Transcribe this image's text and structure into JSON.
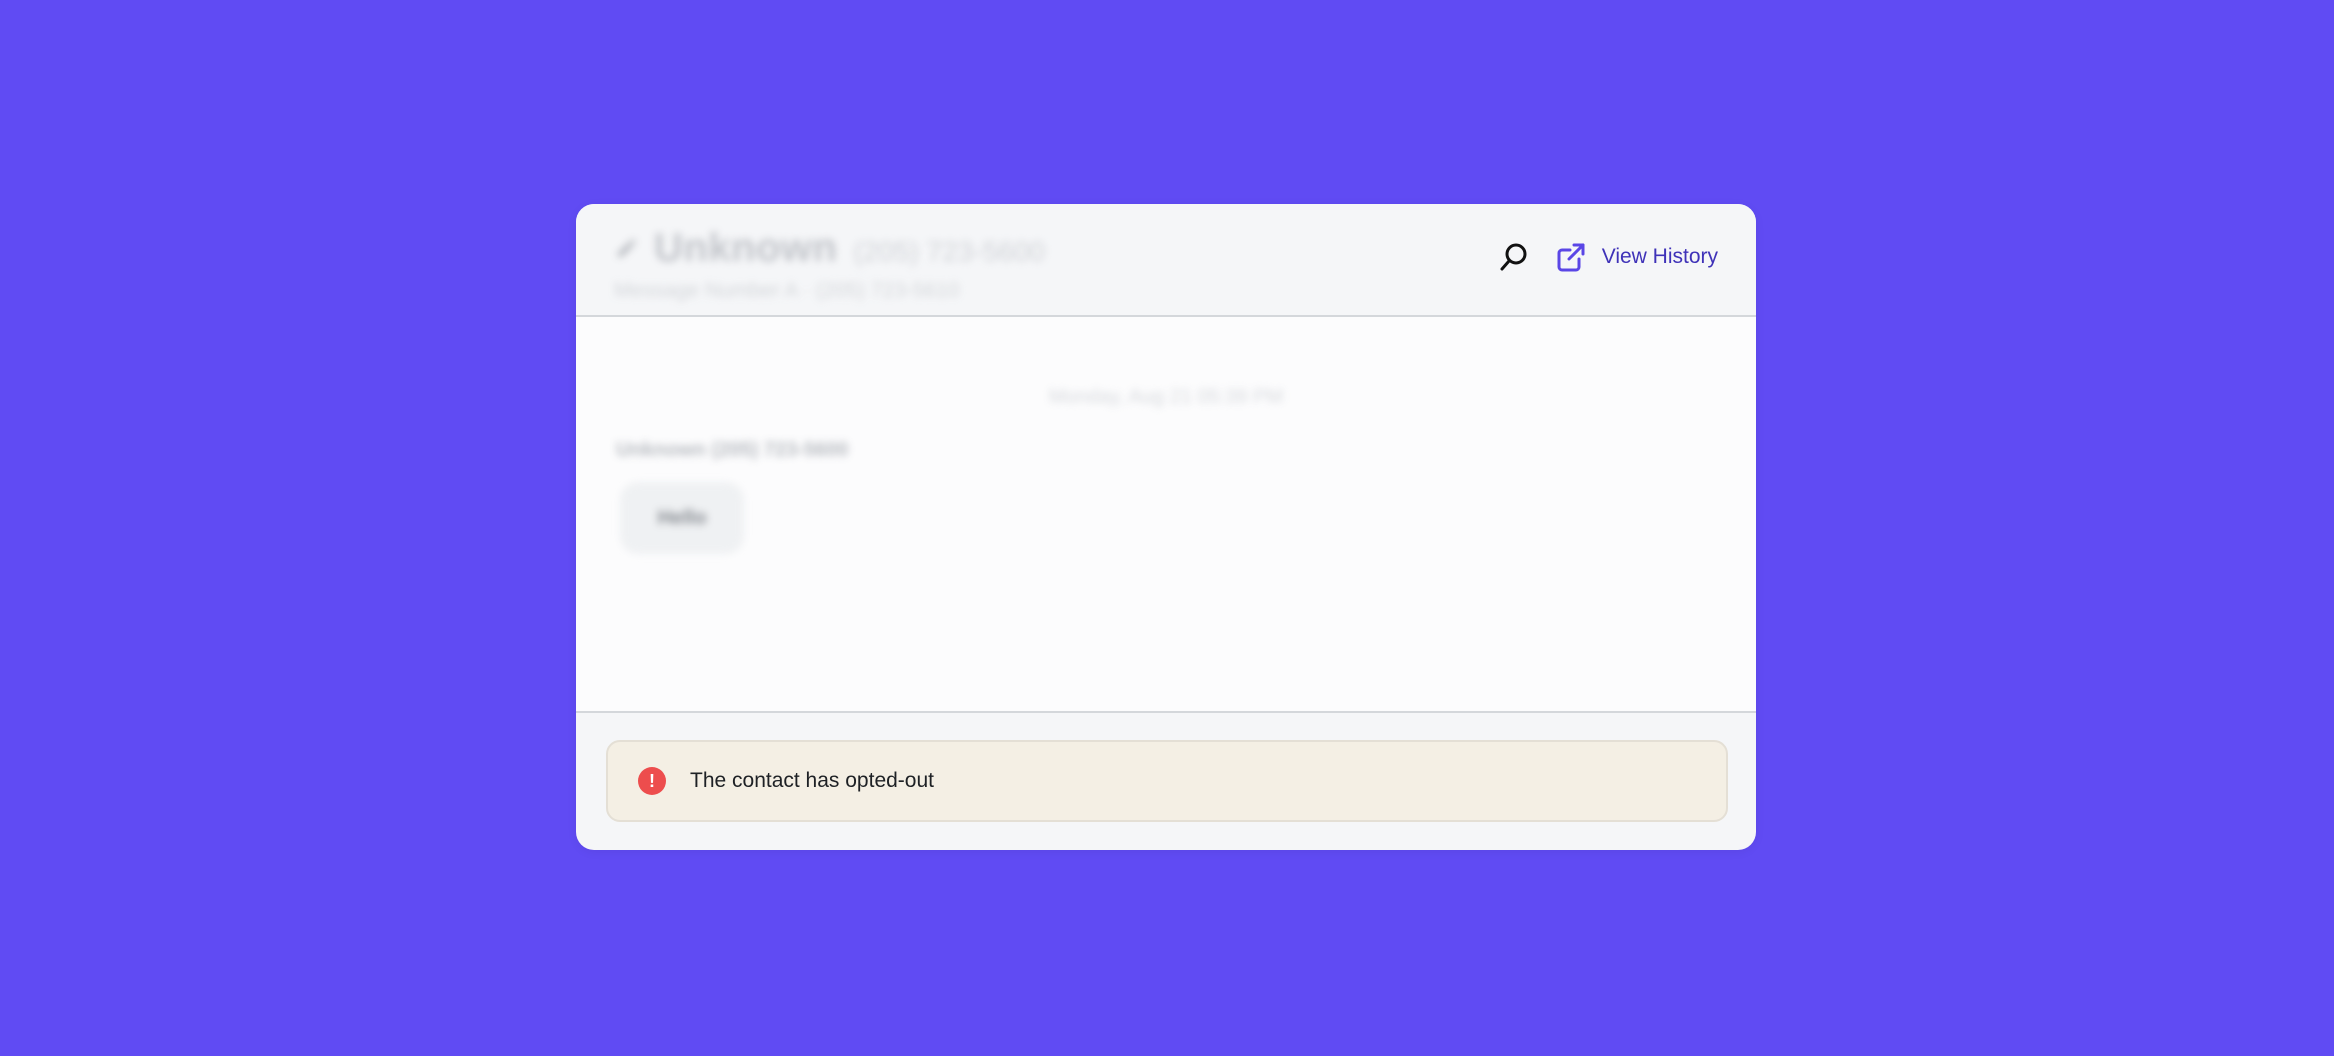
{
  "app": {
    "background_color": "#604BF3",
    "accent_color": "#3F32B8"
  },
  "header": {
    "contact_name": "Unknown",
    "contact_number": "(205) 723-5600",
    "subline": "Message Number A · (205) 723-5610",
    "search_icon": "search-icon",
    "view_history_icon": "external-link-icon",
    "view_history_label": "View History"
  },
  "messages": {
    "date_label": "Monday, Aug 21 05:39 PM",
    "sender_label": "Unknown (205) 723-5600",
    "items": [
      {
        "text": "Hello"
      }
    ]
  },
  "alert": {
    "icon": "exclamation-icon",
    "color": "#ED4D4D",
    "text": "The contact has opted-out"
  }
}
